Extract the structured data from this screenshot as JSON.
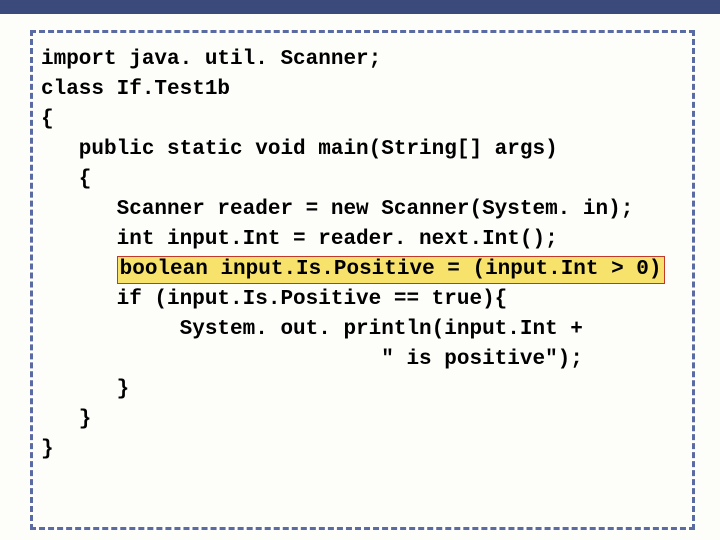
{
  "code": {
    "l1": "import java. util. Scanner;",
    "l2": "",
    "l3": "class If.Test1b",
    "l4": "{",
    "l5": "   public static void main(String[] args)",
    "l6": "   {",
    "l7": "      Scanner reader = new Scanner(System. in);",
    "l8": "      int input.Int = reader. next.Int();",
    "l9a": "      ",
    "l9b": "boolean input.Is.Positive = (input.Int > 0)",
    "l10": "      if (input.Is.Positive == true){",
    "l11": "           System. out. println(input.Int +",
    "l12": "                           \" is positive\");",
    "l13": "      }",
    "l14": "   }",
    "l15": "}"
  }
}
